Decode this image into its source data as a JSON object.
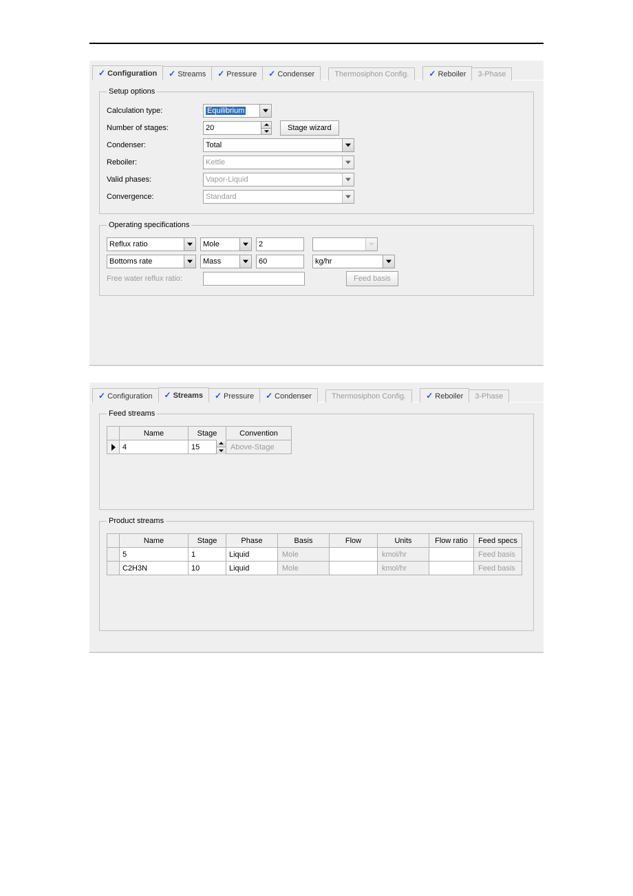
{
  "topTabs": {
    "configuration": "Configuration",
    "streams": "Streams",
    "pressure": "Pressure",
    "condenser": "Condenser",
    "thermosiphon": "Thermosiphon Config.",
    "reboiler": "Reboiler",
    "threephase": "3-Phase"
  },
  "setup": {
    "legend": "Setup options",
    "calcTypeLabel": "Calculation type:",
    "calcType": "Equilibrium",
    "numStagesLabel": "Number of stages:",
    "numStages": "20",
    "stageWizard": "Stage wizard",
    "condenserLabel": "Condenser:",
    "condenser": "Total",
    "reboilerLabel": "Reboiler:",
    "reboiler": "Kettle",
    "validPhasesLabel": "Valid phases:",
    "validPhases": "Vapor-Liquid",
    "convergenceLabel": "Convergence:",
    "convergence": "Standard"
  },
  "operating": {
    "legend": "Operating specifications",
    "spec1": "Reflux ratio",
    "basis1": "Mole",
    "value1": "2",
    "unit1": "",
    "spec2": "Bottoms rate",
    "basis2": "Mass",
    "value2": "60",
    "unit2": "kg/hr",
    "freeWaterLabel": "Free water reflux ratio:",
    "freeWater": "",
    "feedBasis": "Feed basis"
  },
  "feedStreams": {
    "legend": "Feed streams",
    "headers": {
      "name": "Name",
      "stage": "Stage",
      "convention": "Convention"
    },
    "row": {
      "name": "4",
      "stage": "15",
      "convention": "Above-Stage"
    }
  },
  "productStreams": {
    "legend": "Product streams",
    "headers": {
      "name": "Name",
      "stage": "Stage",
      "phase": "Phase",
      "basis": "Basis",
      "flow": "Flow",
      "units": "Units",
      "flowRatio": "Flow ratio",
      "feedSpecs": "Feed specs"
    },
    "rows": [
      {
        "name": "5",
        "stage": "1",
        "phase": "Liquid",
        "basis": "Mole",
        "flow": "",
        "units": "kmol/hr",
        "flowRatio": "",
        "feedSpecs": "Feed basis"
      },
      {
        "name": "C2H3N",
        "stage": "10",
        "phase": "Liquid",
        "basis": "Mole",
        "flow": "",
        "units": "kmol/hr",
        "flowRatio": "",
        "feedSpecs": "Feed basis"
      }
    ]
  }
}
